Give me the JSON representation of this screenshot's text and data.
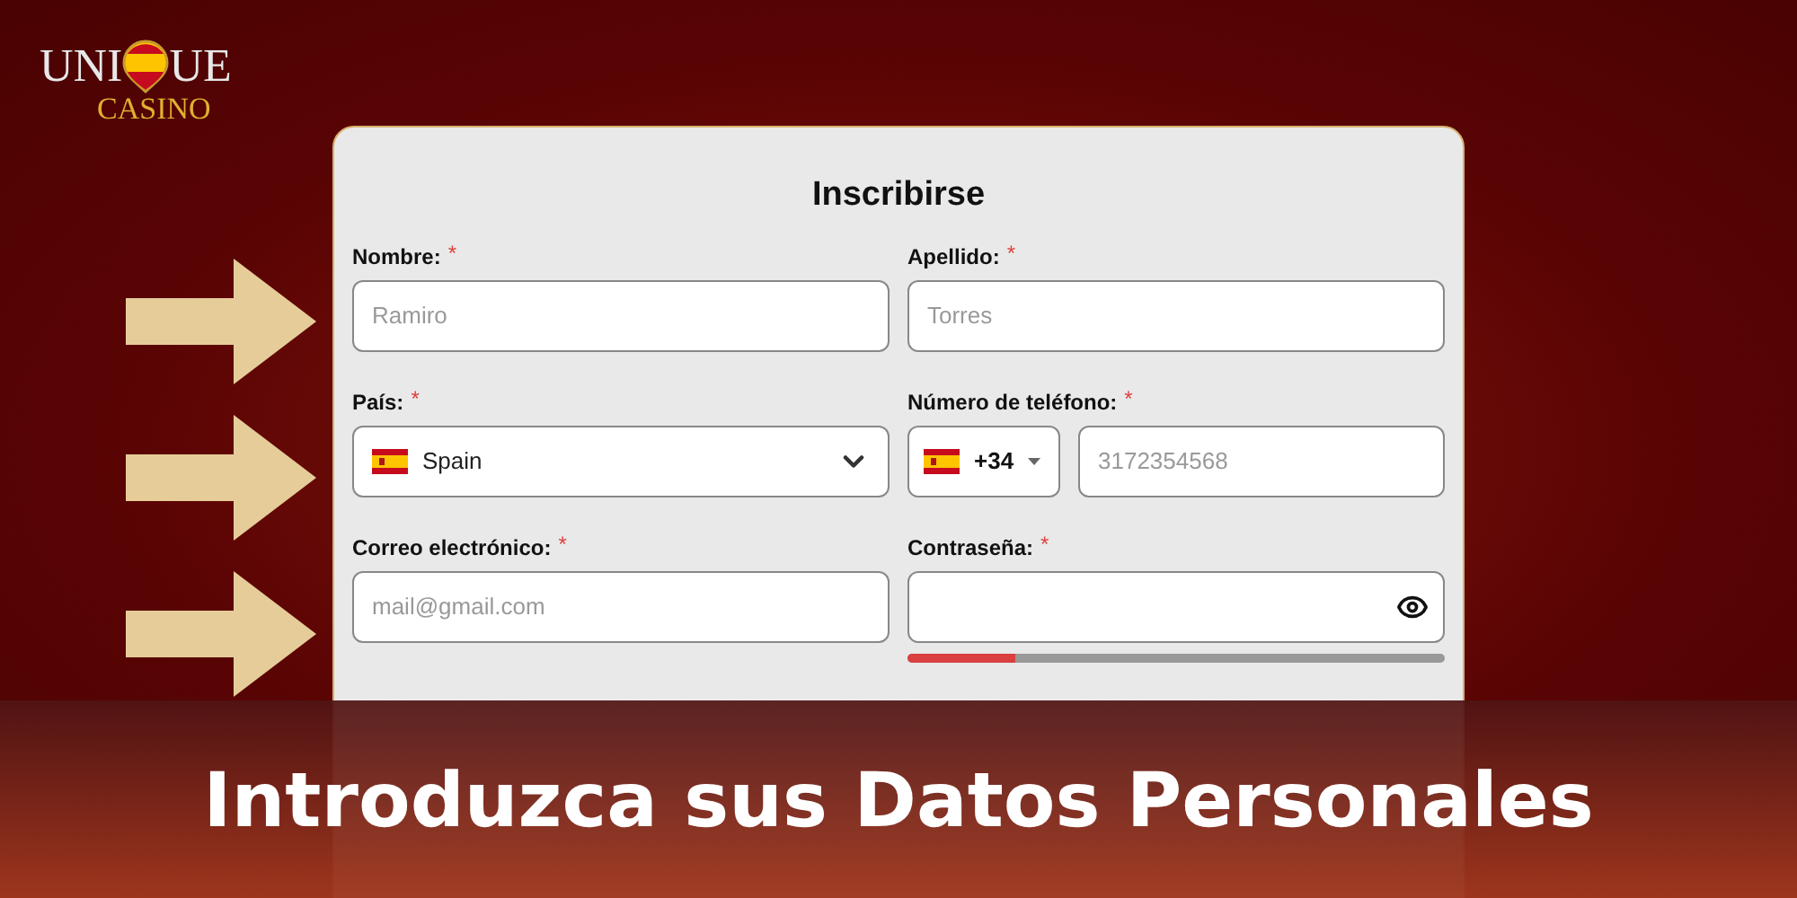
{
  "logo": {
    "text_before": "UNI",
    "text_after": "UE",
    "subtitle": "CASINO"
  },
  "form": {
    "title": "Inscribirse",
    "rows": [
      [
        {
          "kind": "text",
          "label": "Nombre:",
          "required_mark": "*",
          "placeholder": "Ramiro"
        },
        {
          "kind": "text",
          "label": "Apellido:",
          "required_mark": "*",
          "placeholder": "Torres"
        }
      ],
      [
        {
          "kind": "select",
          "label": "País:",
          "required_mark": "*",
          "value": "Spain"
        },
        {
          "kind": "phone",
          "label": "Número de teléfono:",
          "required_mark": "*",
          "code": "+34",
          "placeholder": "3172354568"
        }
      ],
      [
        {
          "kind": "text",
          "label": "Correo electrónico:",
          "required_mark": "*",
          "placeholder": "mail@gmail.com"
        },
        {
          "kind": "password",
          "label": "Contraseña:",
          "required_mark": "*",
          "level": 0.2
        }
      ]
    ]
  },
  "banner": {
    "title": "Introduzca sus Datos Personales"
  }
}
